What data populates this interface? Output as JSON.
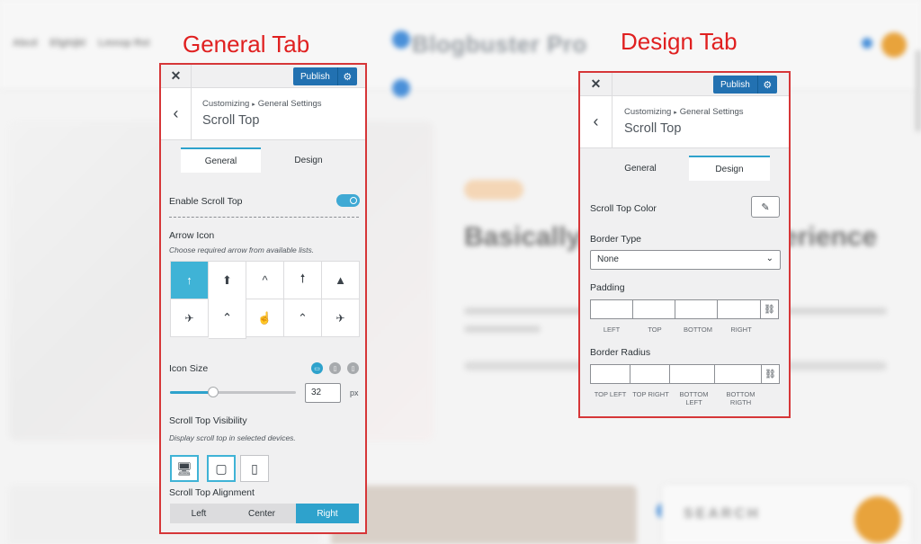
{
  "annotations": {
    "general_tab_label": "General Tab",
    "design_tab_label": "Design Tab"
  },
  "background_site": {
    "nav": [
      "Abcd",
      "Efghijkl",
      "Lmnop Rst"
    ],
    "brand": "Blogbuster Pro",
    "hero_title": "Basically, A Creative Experience",
    "sidebar_heading": "SEARCH"
  },
  "general_panel": {
    "close_icon": "close-icon",
    "publish_label": "Publish",
    "breadcrumb": {
      "root": "Customizing",
      "section": "General Settings"
    },
    "title": "Scroll Top",
    "tabs": [
      {
        "label": "General",
        "active": true
      },
      {
        "label": "Design",
        "active": false
      }
    ],
    "enable_label": "Enable Scroll Top",
    "enable_on": true,
    "arrow_icon": {
      "label": "Arrow Icon",
      "desc": "Choose required arrow from available lists.",
      "icons": [
        {
          "name": "arrow-up-icon",
          "glyph": "↑",
          "active": true
        },
        {
          "name": "circle-arrow-up-icon",
          "glyph": "⬆",
          "active": false
        },
        {
          "name": "caret-up-icon",
          "glyph": "^",
          "active": false
        },
        {
          "name": "long-arrow-up-icon",
          "glyph": "🠕",
          "active": false
        },
        {
          "name": "triangle-up-icon",
          "glyph": "▲",
          "active": false
        },
        {
          "name": "plane-icon",
          "glyph": "✈",
          "active": false
        },
        {
          "name": "double-chevron-up-icon",
          "glyph": "⌃",
          "active": false
        },
        {
          "name": "hand-pointer-icon",
          "glyph": "☝",
          "active": false
        },
        {
          "name": "circle-chevron-up-icon",
          "glyph": "⌃",
          "active": false
        },
        {
          "name": "plane-up-icon",
          "glyph": "✈",
          "active": false
        }
      ]
    },
    "icon_size": {
      "label": "Icon Size",
      "value": "32",
      "unit": "px",
      "slider_fraction": 0.34
    },
    "visibility": {
      "label": "Scroll Top Visibility",
      "desc": "Display scroll top in selected devices.",
      "devices": [
        {
          "name": "desktop-icon",
          "active": true
        },
        {
          "name": "tablet-icon",
          "active": true
        },
        {
          "name": "mobile-icon",
          "active": false
        }
      ]
    },
    "alignment": {
      "label": "Scroll Top Alignment",
      "options": [
        {
          "label": "Left",
          "active": false
        },
        {
          "label": "Center",
          "active": false
        },
        {
          "label": "Right",
          "active": true
        }
      ]
    }
  },
  "design_panel": {
    "publish_label": "Publish",
    "breadcrumb": {
      "root": "Customizing",
      "section": "General Settings"
    },
    "title": "Scroll Top",
    "tabs": [
      {
        "label": "General",
        "active": false
      },
      {
        "label": "Design",
        "active": true
      }
    ],
    "color_label": "Scroll Top Color",
    "border_type": {
      "label": "Border Type",
      "value": "None"
    },
    "padding": {
      "label": "Padding",
      "sides": [
        "LEFT",
        "TOP",
        "BOTTOM",
        "RIGHT"
      ]
    },
    "border_radius": {
      "label": "Border Radius",
      "corners": [
        "TOP LEFT",
        "TOP RIGHT",
        "BOTTOM LEFT",
        "BOTTOM RIGTH"
      ]
    }
  }
}
